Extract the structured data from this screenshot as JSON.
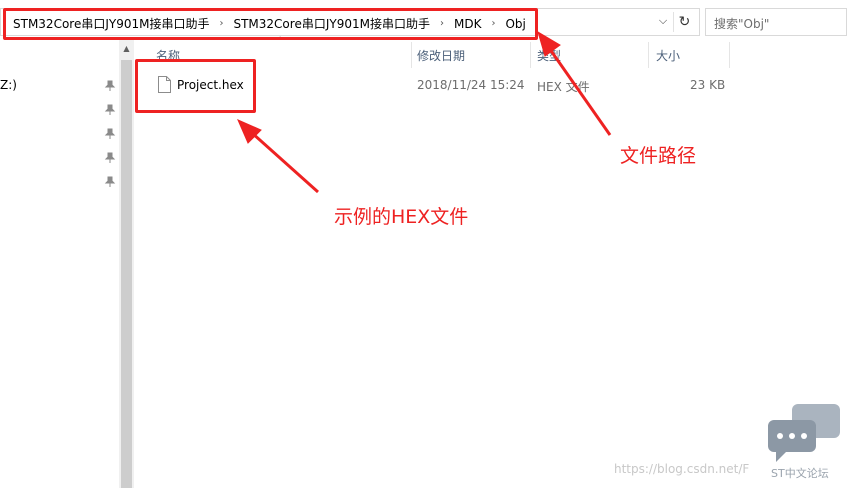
{
  "address_bar": {
    "breadcrumbs": [
      "STM32Core串口JY901M接串口助手",
      "STM32Core串口JY901M接串口助手",
      "MDK",
      "Obj"
    ],
    "separator": "›",
    "dropdown_glyph": "⌵",
    "refresh_glyph": "↻"
  },
  "search": {
    "placeholder": "搜索\"Obj\""
  },
  "nav": {
    "drive_label": "Z:)",
    "pin_glyph": "📌"
  },
  "columns": {
    "name": "名称",
    "date": "修改日期",
    "type": "类型",
    "size": "大小",
    "sort_glyph": "^"
  },
  "files": [
    {
      "name": "Project.hex",
      "date": "2018/11/24 15:24",
      "type": "HEX 文件",
      "size": "23 KB"
    }
  ],
  "annotations": {
    "path_label": "文件路径",
    "hex_label": "示例的HEX文件",
    "color": "#ee2222"
  },
  "watermark": {
    "url": "https://blog.csdn.net/F",
    "brand": "ST中文论坛"
  }
}
